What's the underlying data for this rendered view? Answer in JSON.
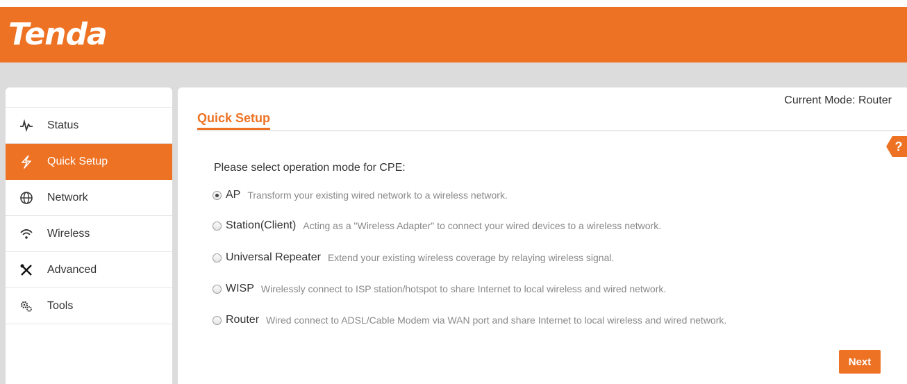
{
  "brand": {
    "logo_text": "Tenda",
    "accent_color": "#ee7223"
  },
  "header": {
    "current_mode_label": "Current Mode: Router"
  },
  "sidebar": {
    "items": [
      {
        "label": "Status",
        "icon": "pulse-icon",
        "active": false
      },
      {
        "label": "Quick Setup",
        "icon": "lightning-icon",
        "active": true
      },
      {
        "label": "Network",
        "icon": "globe-icon",
        "active": false
      },
      {
        "label": "Wireless",
        "icon": "wifi-icon",
        "active": false
      },
      {
        "label": "Advanced",
        "icon": "tools-cross-icon",
        "active": false
      },
      {
        "label": "Tools",
        "icon": "gears-icon",
        "active": false
      }
    ]
  },
  "main": {
    "title": "Quick Setup",
    "help_label": "?",
    "prompt": "Please select operation mode for CPE:",
    "selected_mode": "AP",
    "options": [
      {
        "name": "AP",
        "description": "Transform your existing wired network to a wireless network."
      },
      {
        "name": "Station(Client)",
        "description": "Acting as a \"Wireless Adapter\" to connect your wired devices to a wireless network."
      },
      {
        "name": "Universal Repeater",
        "description": "Extend your existing wireless coverage by relaying wireless signal."
      },
      {
        "name": "WISP",
        "description": "Wirelessly connect to ISP station/hotspot to share Internet to local wireless and wired network."
      },
      {
        "name": "Router",
        "description": "Wired connect to ADSL/Cable Modem via WAN port and share Internet to local wireless and wired network."
      }
    ],
    "next_label": "Next"
  }
}
